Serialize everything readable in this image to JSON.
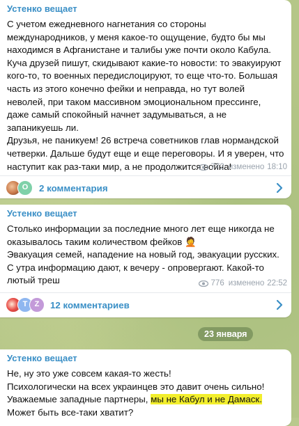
{
  "posts": [
    {
      "author": "Устенко вещает",
      "lines": [
        "С учетом ежедневного нагнетания со стороны",
        "международников, у меня какое-то ощущение, будто бы мы",
        "находимся в Афганистане и талибы уже почти около Кабула.",
        "Куча друзей пишут, скидывают какие-то новости: то эвакуируют",
        "кого-то, то военных передислоцируют, то еще что-то. Большая",
        "часть из этого конечно фейки и неправда, но тут волей",
        "неволей, при таком массивном эмоциональном прессинге,",
        "даже самый спокойный начнет задумываться, а не",
        "запаникуешь ли.",
        "Друзья, не паникуем! 26 встреча советников глав нормандской",
        "четверки. Дальше будут еще и еще переговоры. И я уверен, что",
        "наступит как раз-таки мир, а не продолжится война!"
      ],
      "views": "772",
      "edited": "изменено",
      "time": "18:10",
      "comments": "2 комментария"
    },
    {
      "author": "Устенко вещает",
      "lines": [
        "Столько информации за последние много лет еще никогда не",
        "оказывалось таким количеством фейков 🤦",
        "Эвакуация семей, нападение на новый год, эвакуации русских.",
        "С утра информацию дают, к вечеру - опровергают. Какой-то",
        "лютый треш"
      ],
      "views": "776",
      "edited": "изменено",
      "time": "22:52",
      "comments": "12 комментариев"
    }
  ],
  "date_separator": "23 января",
  "post3": {
    "author": "Устенко вещает",
    "line1": "Не, ну это уже совсем какая-то жесть!",
    "line2": "Психологически на всех украинцев это давит очень сильно!",
    "line3_prefix": "Уважаемые западные партнеры, ",
    "line3_highlight": "мы не Кабул и не Дамаск.",
    "line4": "Может быть все-таки хватит?"
  },
  "avatars": {
    "post1": [
      "photo",
      "О"
    ],
    "post2": [
      "photo",
      "T",
      "Z"
    ]
  },
  "colors": {
    "accent": "#3a8fc6",
    "highlight": "#f2ee2c",
    "meta": "#9aa3ad",
    "background": "#b5c688"
  }
}
